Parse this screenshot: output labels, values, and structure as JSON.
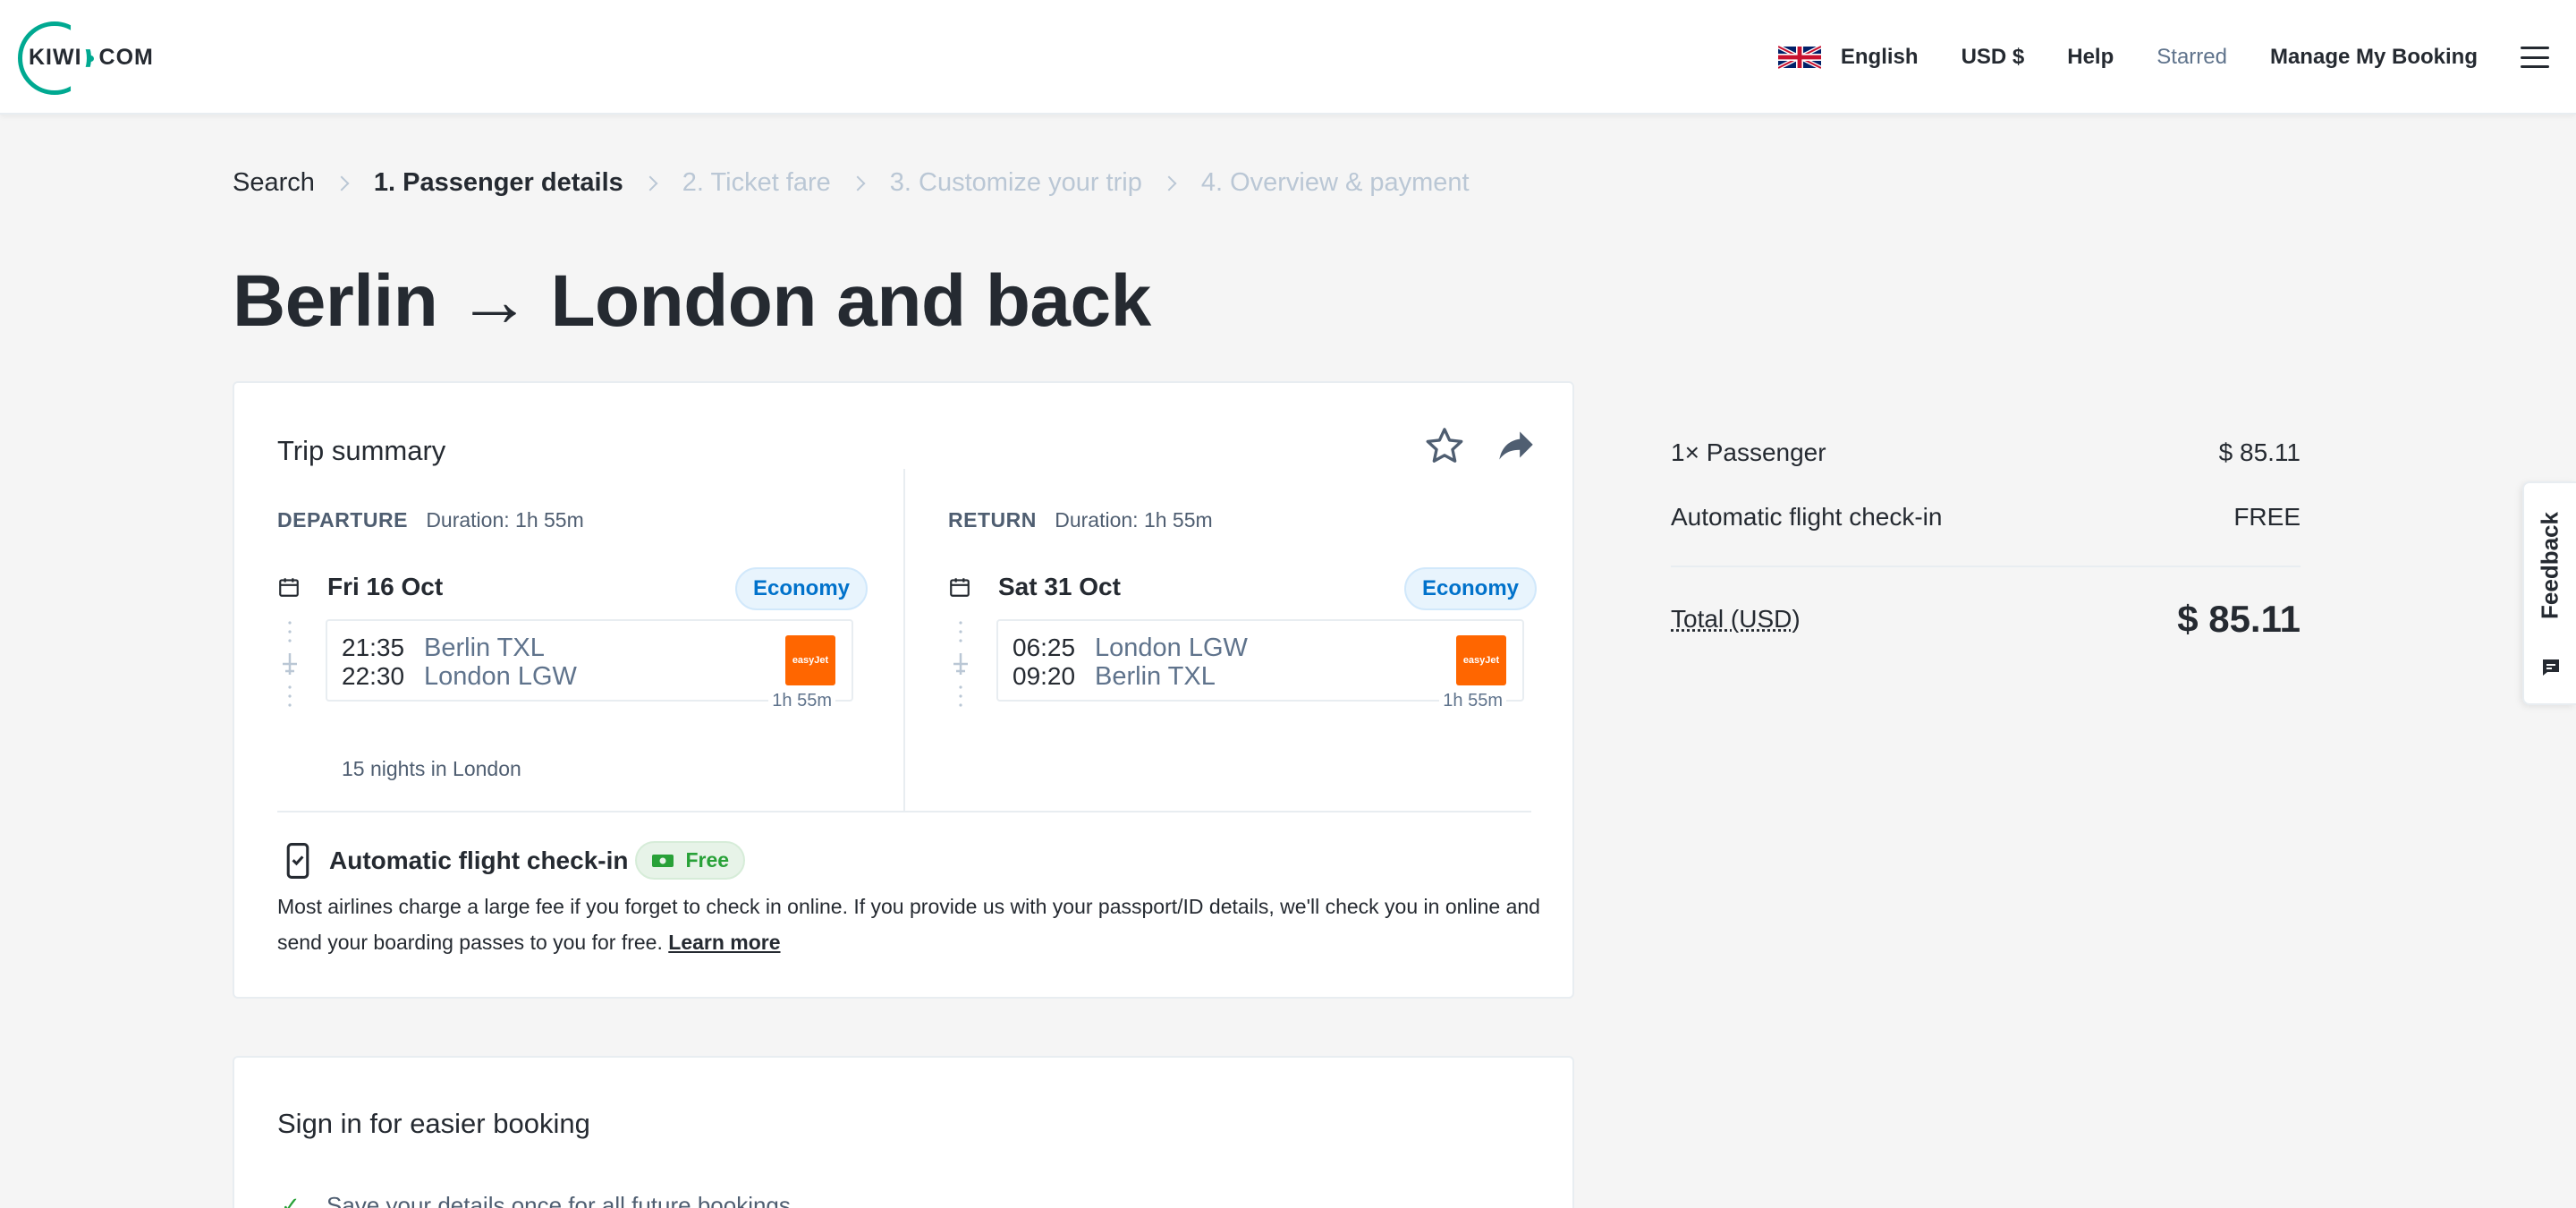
{
  "header": {
    "logo_text": "KIWI",
    "logo_suffix": "COM",
    "language": "English",
    "currency": "USD $",
    "help": "Help",
    "starred": "Starred",
    "manage_booking": "Manage My Booking"
  },
  "breadcrumb": [
    "Search",
    "1. Passenger details",
    "2. Ticket fare",
    "3. Customize your trip",
    "4. Overview & payment"
  ],
  "title": "Berlin → London and back",
  "trip": {
    "title": "Trip summary",
    "departure": {
      "type": "DEPARTURE",
      "duration": "Duration: 1h 55m",
      "date": "Fri 16 Oct",
      "class": "Economy",
      "dep_time": "21:35",
      "arr_time": "22:30",
      "from": "Berlin TXL",
      "to": "London LGW",
      "airline": "easyJet",
      "seg_duration": "1h 55m",
      "nights": "15 nights in London"
    },
    "return": {
      "type": "RETURN",
      "duration": "Duration: 1h 55m",
      "date": "Sat 31 Oct",
      "class": "Economy",
      "dep_time": "06:25",
      "arr_time": "09:20",
      "from": "London LGW",
      "to": "Berlin TXL",
      "airline": "easyJet",
      "seg_duration": "1h 55m"
    },
    "checkin": {
      "title": "Automatic flight check-in",
      "badge": "Free",
      "text": "Most airlines charge a large fee if you forget to check in online. If you provide us with your passport/ID details, we'll check you in online and send your boarding passes to you for free.",
      "link": "Learn more"
    }
  },
  "signin": {
    "title": "Sign in for easier booking",
    "item": "Save your details once for all future bookings"
  },
  "price": {
    "passenger_label": "1× Passenger",
    "passenger_value": "$ 85.11",
    "checkin_label": "Automatic flight check-in",
    "checkin_value": "FREE",
    "total_label": "Total (USD)",
    "total_value": "$ 85.11"
  },
  "feedback": "Feedback",
  "colors": {
    "brand": "#00a991",
    "economy_badge": "#0172cb",
    "free_badge": "#28a138",
    "airline": "#ff6600"
  }
}
